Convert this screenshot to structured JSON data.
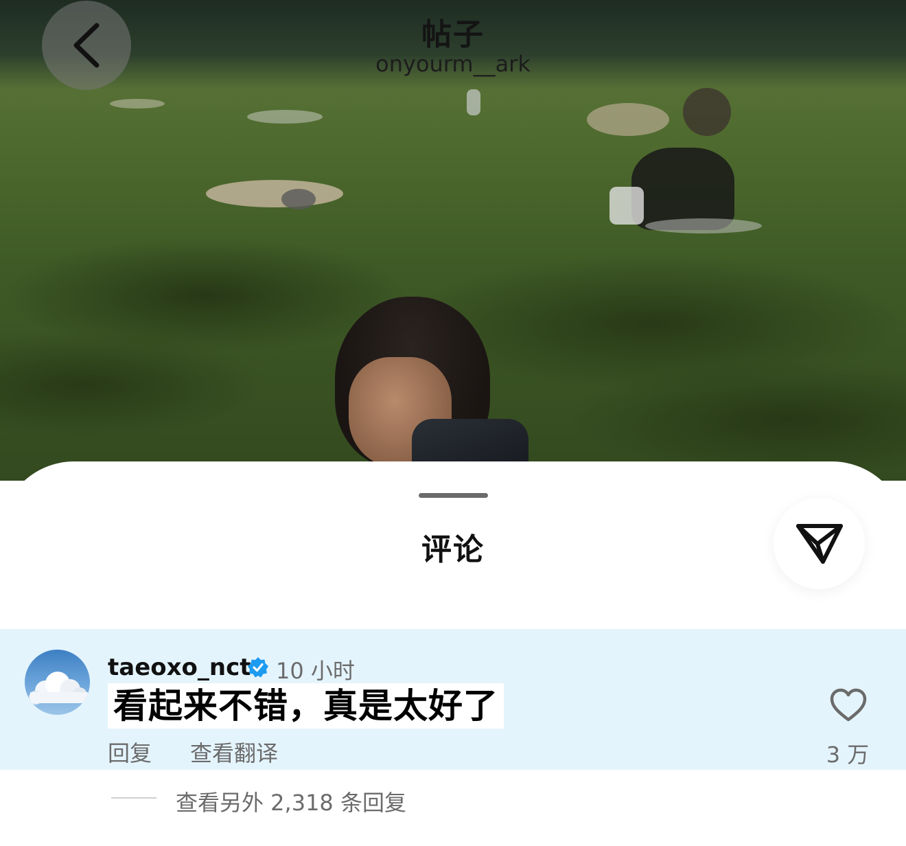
{
  "header": {
    "title": "帖子",
    "subtitle": "onyourm__ark",
    "back_icon": "chevron-left-icon"
  },
  "sheet": {
    "title": "评论",
    "share_icon": "paper-plane-icon"
  },
  "comment": {
    "username": "taeoxo_nct",
    "verified_icon": "verified-badge-icon",
    "time": "10 小时",
    "text": "看起来不错，真是太好了",
    "reply_label": "回复",
    "translate_label": "查看翻译",
    "like_icon": "heart-icon",
    "like_count": "3 万",
    "view_replies": "查看另外 2,318 条回复"
  },
  "colors": {
    "comment_highlight": "#e4f4fd",
    "verified_blue": "#1d9bf0",
    "secondary_text": "#6b6b6b"
  }
}
